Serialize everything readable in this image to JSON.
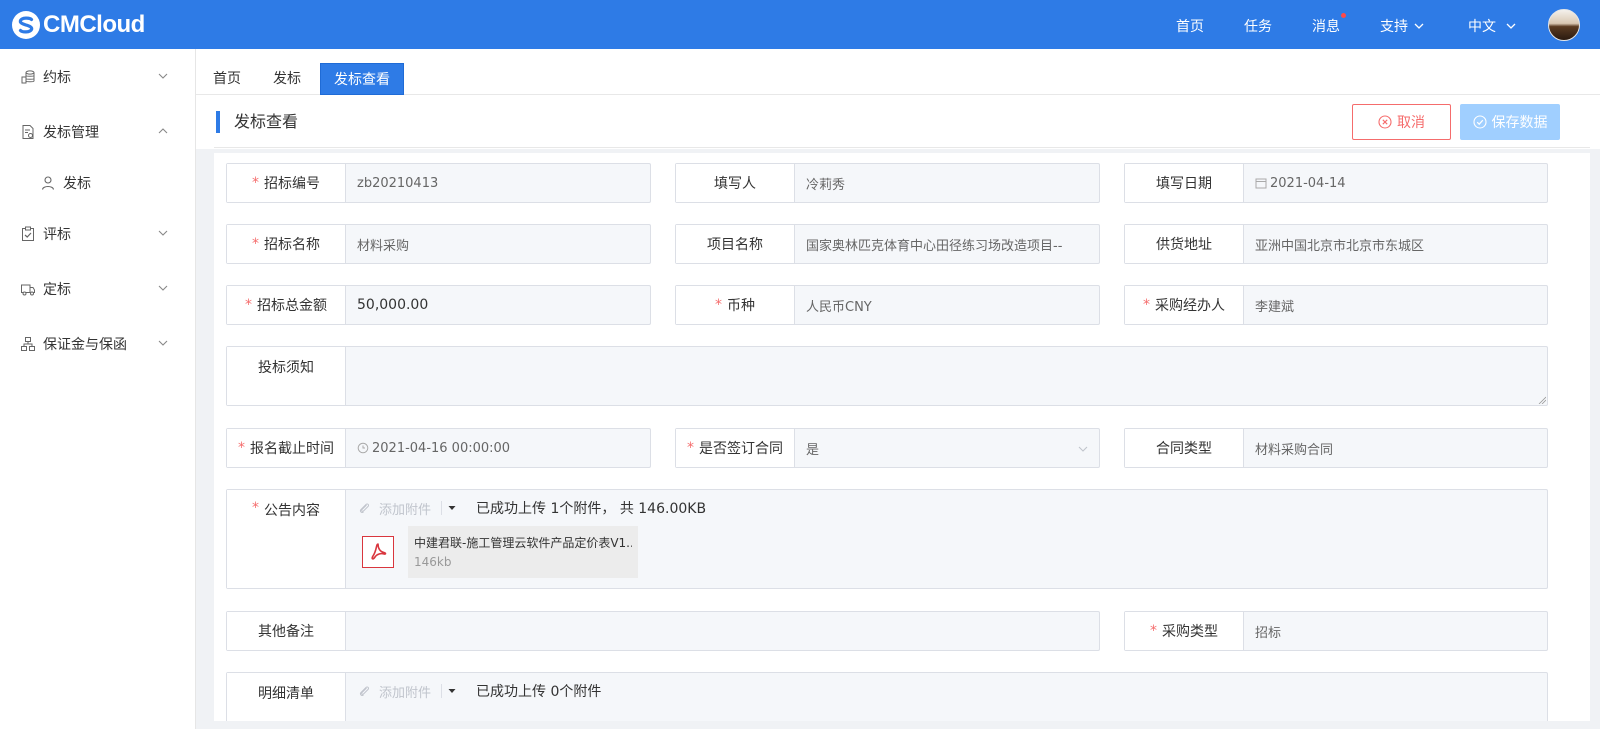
{
  "header": {
    "logo_text": "CMCloud",
    "nav": {
      "home": "首页",
      "tasks": "任务",
      "messages": "消息",
      "support": "支持",
      "language": "中文"
    }
  },
  "sidebar": {
    "items": [
      {
        "label": "约标",
        "icon": "coins-icon"
      },
      {
        "label": "发标管理",
        "icon": "document-settings-icon"
      },
      {
        "label": "发标",
        "icon": "user-icon"
      },
      {
        "label": "评标",
        "icon": "clipboard-check-icon"
      },
      {
        "label": "定标",
        "icon": "truck-icon"
      },
      {
        "label": "保证金与保函",
        "icon": "hierarchy-icon"
      }
    ]
  },
  "tabs": [
    "首页",
    "发标",
    "发标查看"
  ],
  "panel": {
    "title": "发标查看",
    "cancel_label": "取消",
    "save_label": "保存数据"
  },
  "form": {
    "bid_no": {
      "label": "招标编号",
      "value": "zb20210413"
    },
    "author": {
      "label": "填写人",
      "value": "冷莉秀"
    },
    "fill_date": {
      "label": "填写日期",
      "value": "2021-04-14"
    },
    "bid_name": {
      "label": "招标名称",
      "value": "材料采购"
    },
    "project_name": {
      "label": "项目名称",
      "value": "国家奥林匹克体育中心田径练习场改造项目--"
    },
    "supply_address": {
      "label": "供货地址",
      "value": "亚洲中国北京市北京市东城区"
    },
    "bid_amount": {
      "label": "招标总金额",
      "value": "50,000.00"
    },
    "currency": {
      "label": "币种",
      "value": "人民币CNY"
    },
    "buyer": {
      "label": "采购经办人",
      "value": "李建斌"
    },
    "notice": {
      "label": "投标须知",
      "value": ""
    },
    "deadline": {
      "label": "报名截止时间",
      "value": "2021-04-16 00:00:00"
    },
    "sign_contract": {
      "label": "是否签订合同",
      "value": "是"
    },
    "contract_type": {
      "label": "合同类型",
      "value": "材料采购合同"
    },
    "announcement": {
      "label": "公告内容",
      "upload_label": "添加附件",
      "status": "已成功上传 1个附件， 共 146.00KB",
      "file_name": "中建君联-施工管理云软件产品定价表V1...",
      "file_size": "146kb"
    },
    "other_notes": {
      "label": "其他备注",
      "value": ""
    },
    "purchase_type": {
      "label": "采购类型",
      "value": "招标"
    },
    "detail_list": {
      "label": "明细清单",
      "upload_label": "添加附件",
      "status": "已成功上传 0个附件"
    }
  },
  "colors": {
    "primary": "#2e7be6",
    "danger": "#f56c6c",
    "disabled_primary": "#a0cfff"
  }
}
